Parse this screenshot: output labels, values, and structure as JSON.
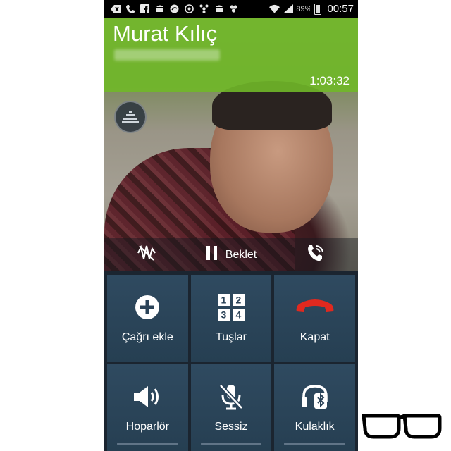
{
  "status_bar": {
    "icons": [
      "back-icon",
      "phone-icon",
      "facebook-icon",
      "android-icon",
      "record-icon",
      "whatsapp-icon",
      "pinwheel-icon",
      "android-icon",
      "clover-icon",
      "wifi-icon",
      "signal-icon"
    ],
    "battery": "89%",
    "time": "00:57"
  },
  "call": {
    "caller_name": "Murat Kılıç",
    "timer": "1:03:32",
    "hold_label": "Beklet"
  },
  "buttons": [
    {
      "label": "Çağrı ekle",
      "icon": "add-call-icon"
    },
    {
      "label": "Tuşlar",
      "icon": "keypad-icon"
    },
    {
      "label": "Kapat",
      "icon": "end-call-icon"
    },
    {
      "label": "Hoparlör",
      "icon": "speaker-icon"
    },
    {
      "label": "Sessiz",
      "icon": "mute-icon"
    },
    {
      "label": "Kulaklık",
      "icon": "bluetooth-headset-icon"
    }
  ],
  "colors": {
    "header_green": "#70b828",
    "end_call_red": "#e0291f",
    "button_bg": "#2b455a"
  }
}
